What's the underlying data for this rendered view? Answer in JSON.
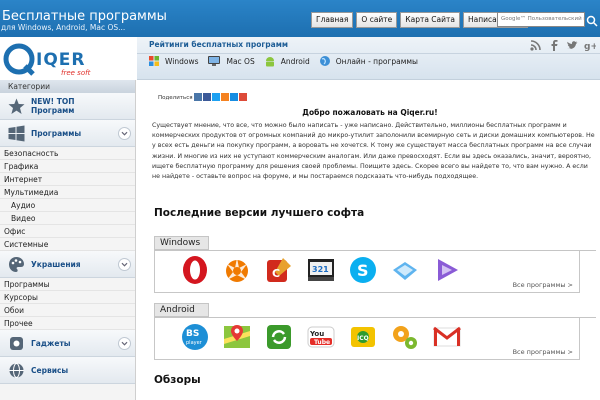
{
  "header": {
    "site_title": "Бесплатные программы",
    "site_subtitle": "для Windows, Android, Mac OS...",
    "nav": [
      "Главная",
      "О сайте",
      "Карта Сайта",
      "Написать нам"
    ],
    "search_placeholder": "Google™ Пользовательский пои"
  },
  "logo": {
    "name": "QIQER",
    "tagline": "free soft"
  },
  "subbar": {
    "title": "Рейтинги бесплатных программ",
    "os_tabs": [
      "Windows",
      "Mac OS",
      "Android",
      "Онлайн - программы"
    ]
  },
  "sidebar": {
    "header": "Категории",
    "new_top": "NEW! ТОП\nПрограмм",
    "programs": "Программы",
    "program_items": [
      "Безопасность",
      "Графика",
      "Интернет",
      "Мультимедиа"
    ],
    "multimedia_items": [
      "Аудио",
      "Видео"
    ],
    "program_items2": [
      "Офис",
      "Системные"
    ],
    "decorations": "Украшения",
    "decoration_items": [
      "Программы",
      "Курсоры",
      "Обои",
      "Прочее"
    ],
    "gadgets": "Гаджеты",
    "services": "Сервисы"
  },
  "main": {
    "share_label": "Поделиться",
    "welcome": "Добро пожаловать на Qiqer.ru!",
    "intro": "Существует мнение, что все, что можно было написать - уже написано. Действительно, миллионы бесплатных программ и коммерческих продуктов от огромных компаний до микро-утилит заполонили всемирную сеть и диски домашних компьютеров. Не у всех есть деньги на покупку программ, а воровать не хочется. К тому же существует масса бесплатных программ на все случаи жизни. И многие из них не уступают коммерческим аналогам. Или даже превосходят. Если вы здесь оказались, значит, вероятно, ищете бесплатную программу для решения своей проблемы. Поищите здесь. Скорее всего вы найдете то, что вам нужно. А если не найдете - оставьте вопрос на форуме, и мы постараемся подсказать что-нибудь подходящее.",
    "latest_title": "Последние версии лучшего софта",
    "windows_label": "Windows",
    "android_label": "Android",
    "all_programs": "Все программы >",
    "reviews_title": "Обзоры",
    "windows_apps": [
      "opera-icon",
      "avast-icon",
      "ccleaner-icon",
      "media-player-classic-icon",
      "skype-icon",
      "cloud-app-icon",
      "media-player-icon"
    ],
    "android_apps": [
      "bsplayer-icon",
      "google-maps-icon",
      "file-sync-icon",
      "youtube-icon",
      "icq-icon",
      "settings-gears-icon",
      "gmail-icon"
    ]
  },
  "colors": {
    "header_blue": "#1d6fb0",
    "link_blue": "#1a4f87"
  }
}
